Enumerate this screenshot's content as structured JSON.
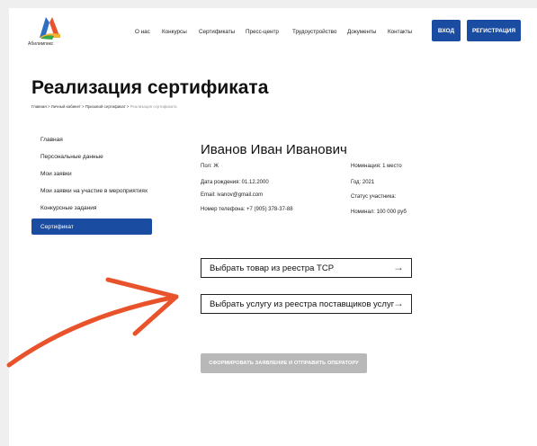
{
  "header": {
    "logo_text": "Абилимпикс",
    "nav": [
      "О нас",
      "Конкурсы",
      "Сертификаты",
      "Пресс-центр",
      "Трудоустройство",
      "Документы",
      "Контакты"
    ],
    "login_label": "ВХОД",
    "register_label": "РЕГИСТРАЦИЯ"
  },
  "page": {
    "title": "Реализация сертификата",
    "breadcrumb": [
      "Главная",
      "Личный кабинет",
      "Призовой сертификат"
    ],
    "breadcrumb_current": "Реализация сертификата",
    "breadcrumb_separator": ">"
  },
  "sidebar": {
    "items": [
      "Главная",
      "Персональные данные",
      "Мои заявки",
      "Мои заявки на участие в мероприятиях",
      "Конкурсные задания"
    ],
    "active": "Сертификат"
  },
  "profile": {
    "name": "Иванов Иван Иванович",
    "left": [
      "Пол: Ж",
      "Дата рождения: 01.12.2000",
      "Email: ivanov@gmail.com",
      "Номер телефона: +7 (905) 378-37-88"
    ],
    "right": [
      "Номинация: 1 место",
      "Год: 2021",
      "Статус участника:",
      "Номинал: 100 000 руб"
    ]
  },
  "actions": {
    "select_goods": "Выбрать товар из реестра ТСР",
    "select_service": "Выбрать услугу из реестра поставщиков услуг",
    "arrow_icon": "arrow-right-icon",
    "submit": "СФОРМИРОВАТЬ ЗАЯВЛЕНИЕ И ОТПРАВИТЬ ОПЕРАТОРУ"
  },
  "colors": {
    "primary": "#1a4da1",
    "disabled": "#b8b8b8",
    "annotation_arrow": "#e8532b"
  }
}
